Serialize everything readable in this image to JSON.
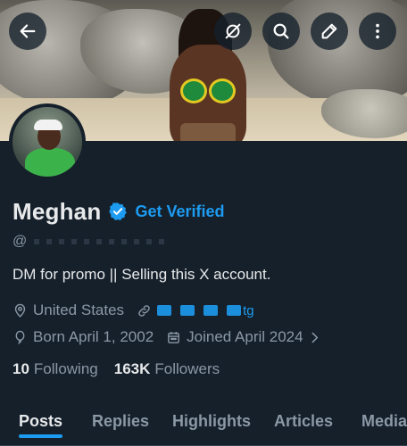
{
  "header": {
    "back_icon": "arrow-left-icon",
    "actions": [
      {
        "icon": "grok-icon"
      },
      {
        "icon": "search-icon"
      },
      {
        "icon": "edit-icon"
      },
      {
        "icon": "more-vertical-icon"
      }
    ]
  },
  "profile": {
    "name": "Meghan",
    "verified_icon": "verified-badge-icon",
    "get_verified_label": "Get Verified",
    "handle_prefix": "@",
    "bio": "DM for promo || Selling this X account.",
    "location": "United States",
    "link_text": "tg",
    "birthday": "Born April 1, 2002",
    "joined": "Joined April 2024",
    "following_count": "10",
    "following_label": "Following",
    "followers_count": "163K",
    "followers_label": "Followers"
  },
  "tabs": [
    {
      "label": "Posts",
      "active": true
    },
    {
      "label": "Replies",
      "active": false
    },
    {
      "label": "Highlights",
      "active": false
    },
    {
      "label": "Articles",
      "active": false
    },
    {
      "label": "Media",
      "active": false
    }
  ],
  "colors": {
    "background": "#15202b",
    "accent": "#1d9bf0",
    "primary_text": "#e7e9ea",
    "secondary_text": "#8b98a5"
  }
}
